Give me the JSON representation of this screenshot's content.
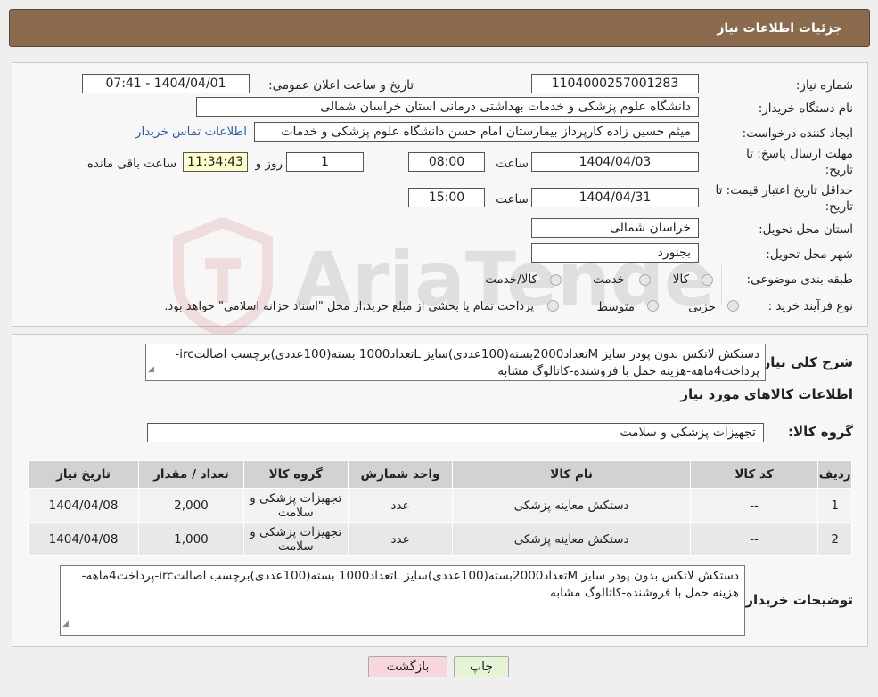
{
  "header": {
    "title": "جزئیات اطلاعات نیاز"
  },
  "form": {
    "need_number_label": "شماره نیاز:",
    "need_number": "1104000257001283",
    "announce_label": "تاریخ و ساعت اعلان عمومی:",
    "announce_value": "1404/04/01 - 07:41",
    "buyer_org_label": "نام دستگاه خریدار:",
    "buyer_org": "دانشگاه علوم پزشکی و خدمات بهداشتی درمانی استان خراسان شمالی",
    "requester_label": "ایجاد کننده درخواست:",
    "requester": "میثم  حسین زاده  کارپرداز بیمارستان امام حسن دانشگاه علوم پزشکی و خدمات",
    "contact_link": "اطلاعات تماس خریدار",
    "deadline_label_1": "مهلت ارسال پاسخ: تا",
    "deadline_label_2": "تاریخ:",
    "deadline_date": "1404/04/03",
    "time_label": "ساعت",
    "deadline_time": "08:00",
    "days_value": "1",
    "days_label": "روز و",
    "remaining_time": "11:34:43",
    "remaining_label": "ساعت باقی مانده",
    "validity_label_1": "حداقل تاریخ اعتبار قیمت: تا",
    "validity_label_2": "تاریخ:",
    "validity_date": "1404/04/31",
    "validity_time": "15:00",
    "province_label": "استان محل تحویل:",
    "province": "خراسان شمالی",
    "city_label": "شهر محل تحویل:",
    "city": "بجنورد",
    "category_label": "طبقه بندی موضوعی:",
    "category_options": [
      "کالا",
      "خدمت",
      "کالا/خدمت"
    ],
    "process_label": "نوع فرآیند خرید :",
    "process_options": [
      "جزیی",
      "متوسط"
    ],
    "process_note": "پرداخت تمام یا بخشی از مبلغ خرید،از محل \"اسناد خزانه اسلامی\" خواهد بود."
  },
  "details": {
    "summary_label": "شرح کلی نیاز:",
    "summary": "دستکش لاتکس بدون پودر سایز Mتعداد2000بسته(100عددی)سایز Lتعداد1000 بسته(100عددی)برچسب اصالتirc-پرداخت4ماهه-هزینه حمل با فروشنده-کاتالوگ مشابه",
    "goods_info_title": "اطلاعات کالاهای مورد نیاز",
    "goods_group_label": "گروه کالا:",
    "goods_group": "تجهیزات پزشکی و سلامت"
  },
  "table": {
    "headers": [
      "ردیف",
      "کد کالا",
      "نام کالا",
      "واحد شمارش",
      "گروه کالا",
      "تعداد / مقدار",
      "تاریخ نیاز"
    ],
    "rows": [
      [
        "1",
        "--",
        "دستکش معاینه پزشکی",
        "عدد",
        "تجهیزات پزشکی و سلامت",
        "2,000",
        "1404/04/08"
      ],
      [
        "2",
        "--",
        "دستکش معاینه پزشکی",
        "عدد",
        "تجهیزات پزشکی و سلامت",
        "1,000",
        "1404/04/08"
      ]
    ]
  },
  "buyer_notes": {
    "label": "توضیحات خریدار:",
    "text": "دستکش لاتکس بدون پودر سایز Mتعداد2000بسته(100عددی)سایز Lتعداد1000 بسته(100عددی)برچسب اصالتirc-پرداخت4ماهه-هزینه حمل با فروشنده-کاتالوگ مشابه"
  },
  "buttons": {
    "print": "چاپ",
    "back": "بازگشت"
  },
  "watermark": {
    "text": "AriaTender.net"
  },
  "colors": {
    "title_bg": "#8b6b4e",
    "link": "#2a5db0",
    "back_btn": "#f8d7dc",
    "print_btn": "#e6f4d6"
  }
}
